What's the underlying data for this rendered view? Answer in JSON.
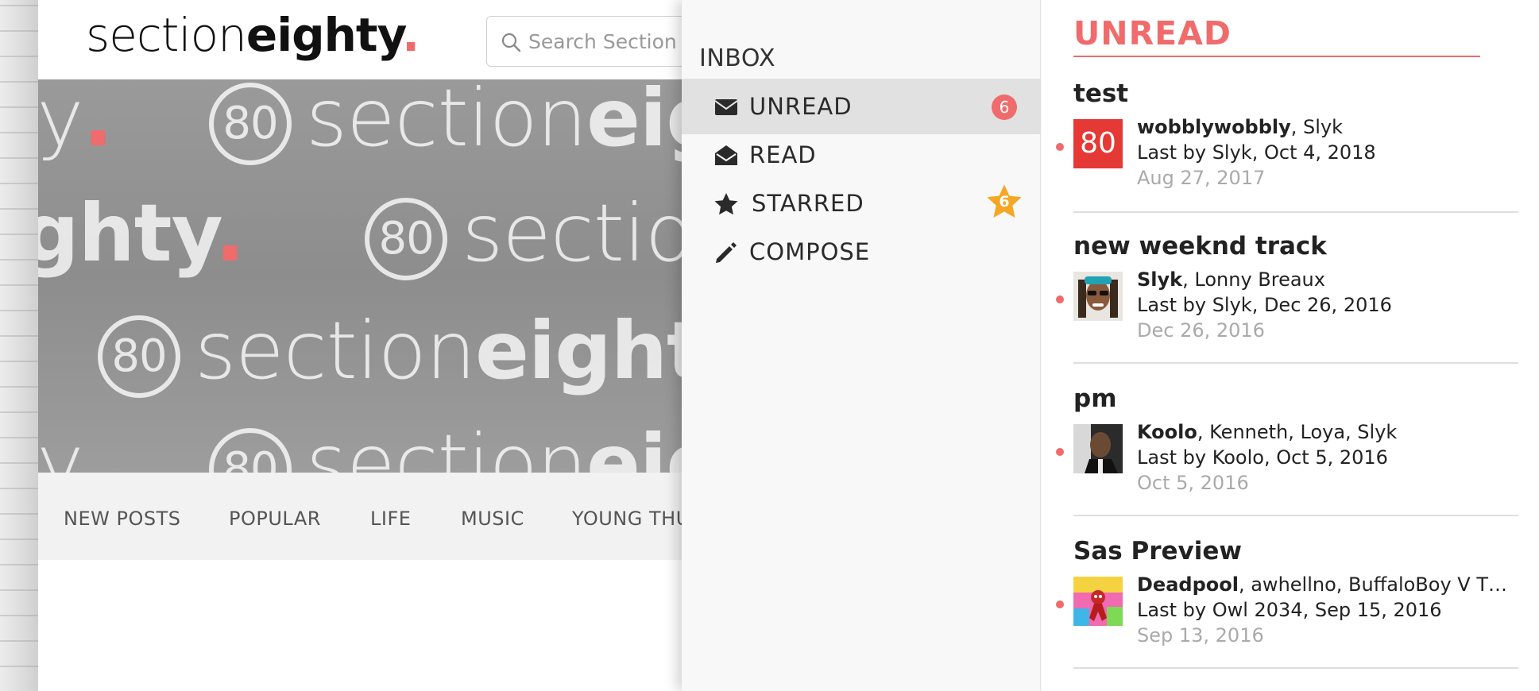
{
  "site": {
    "logo": {
      "light": "section",
      "bold": "eighty",
      "dot": "."
    },
    "search": {
      "placeholder": "Search Section Eighty"
    },
    "banner_watermark": {
      "ring": "80",
      "light": "section",
      "bold": "eighty",
      "dot": "."
    },
    "nav": [
      "NEW POSTS",
      "POPULAR",
      "LIFE",
      "MUSIC",
      "YOUNG THUG"
    ]
  },
  "inbox": {
    "title": "INBOX",
    "folders": [
      {
        "label": "UNREAD",
        "icon": "envelope-icon",
        "badge": "6",
        "active": true
      },
      {
        "label": "READ",
        "icon": "open-envelope-icon",
        "badge": "",
        "active": false
      },
      {
        "label": "STARRED",
        "icon": "star-icon",
        "badge": "6",
        "active": false
      },
      {
        "label": "COMPOSE",
        "icon": "pencil-icon",
        "badge": "",
        "active": false
      }
    ]
  },
  "unread": {
    "heading": "UNREAD",
    "conversations": [
      {
        "title": "test",
        "starter": "wobblywobbly",
        "participants": ", Slyk",
        "last": "Last by Slyk, Oct 4, 2018",
        "date": "Aug 27, 2017",
        "avatar_text": "80"
      },
      {
        "title": "new weeknd track",
        "starter": "Slyk",
        "participants": ", Lonny Breaux",
        "last": "Last by Slyk, Dec 26, 2016",
        "date": "Dec 26, 2016",
        "avatar_text": ""
      },
      {
        "title": "pm",
        "starter": "Koolo",
        "participants": ", Kenneth, Loya, Slyk",
        "last": "Last by Koolo, Oct 5, 2016",
        "date": "Oct 5, 2016",
        "avatar_text": ""
      },
      {
        "title": "Sas Preview",
        "starter": "Deadpool",
        "participants": ", awhellno, BuffaloBoy V Th...",
        "last": "Last by Owl 2034, Sep 15, 2016",
        "date": "Sep 13, 2016",
        "avatar_text": ""
      }
    ]
  },
  "colors": {
    "accent": "#f06b6b",
    "star": "#f5a623",
    "active_row": "#e1e1e1"
  }
}
